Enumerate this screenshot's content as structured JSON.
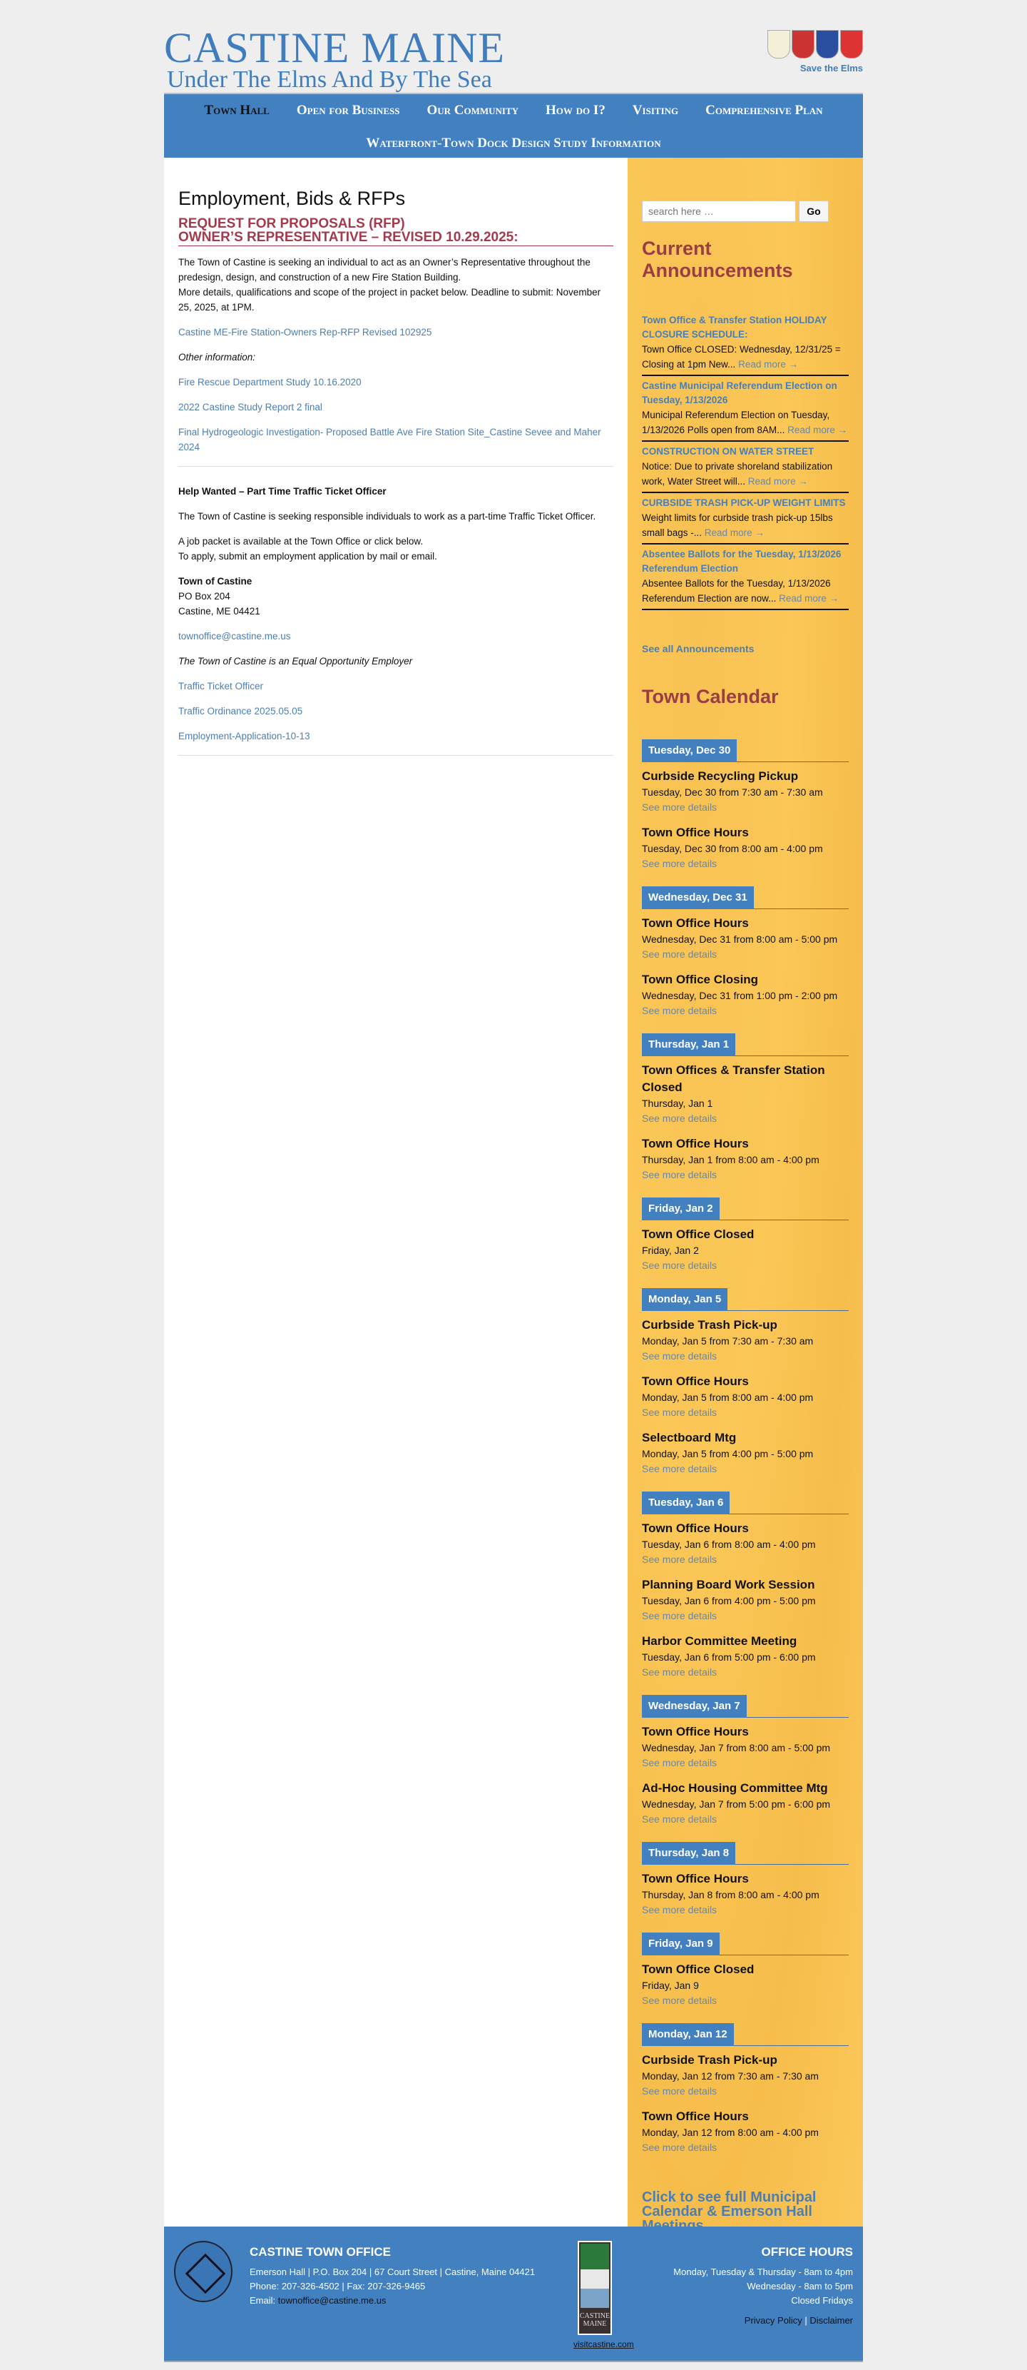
{
  "header": {
    "title": "CASTINE MAINE",
    "tagline": "Under The Elms And By The Sea",
    "save_elms": "Save the Elms",
    "flag_colors": [
      "#f4f0d8",
      "#c33",
      "#2b4fa0",
      "#d33"
    ]
  },
  "nav": {
    "row1": [
      "Town Hall",
      "Open for Business",
      "Our Community",
      "How do I?",
      "Visiting",
      "Comprehensive Plan"
    ],
    "row2": [
      "Waterfront-Town Dock Design Study Information"
    ]
  },
  "main": {
    "title": "Employment, Bids & RFPs",
    "rfp_line1": "REQUEST FOR PROPOSALS (RFP)",
    "rfp_line2": "OWNER’S REPRESENTATIVE – REVISED 10.29.2025:",
    "rfp_p1": "The Town of Castine is seeking an individual to act as an Owner’s Representative throughout the predesign, design, and construction of a new Fire Station Building.",
    "rfp_p2": "More details, qualifications and scope of the project in packet below.  Deadline to submit: November 25, 2025, at 1PM.",
    "rfp_link": "Castine ME-Fire Station-Owners Rep-RFP Revised 102925",
    "other_info": "Other information:",
    "other_links": [
      "Fire Rescue Department Study 10.16.2020",
      "2022 Castine Study Report 2 final",
      "Final Hydrogeologic Investigation- Proposed Battle Ave Fire Station Site_Castine Sevee and Maher 2024"
    ],
    "job_title": "Help Wanted – Part Time Traffic Ticket Officer",
    "job_p1": "The Town of Castine is seeking responsible individuals to work as a part-time Traffic Ticket Officer.",
    "job_p2a": "A job packet is available at the Town Office or click below.",
    "job_p2b": "To apply, submit an employment application by mail or email.",
    "addr_name": "Town of Castine",
    "addr_1": "PO Box 204",
    "addr_2": "Castine, ME 04421",
    "email": "townoffice@castine.me.us",
    "eoe": "The Town of Castine is an Equal Opportunity Employer",
    "job_links": [
      "Traffic Ticket Officer",
      "Traffic Ordinance 2025.05.05",
      "Employment-Application-10-13"
    ]
  },
  "sidebar": {
    "search_placeholder": "search here …",
    "search_button": "Go",
    "announcements_title": "Current Announcements",
    "announcements": [
      {
        "title": "Town Office & Transfer Station HOLIDAY CLOSURE SCHEDULE:",
        "body": "Town Office CLOSED: Wednesday, 12/31/25 = Closing at 1pm New...",
        "more": "Read more →"
      },
      {
        "title": "Castine Municipal Referendum Election on Tuesday, 1/13/2026",
        "body": "Municipal Referendum Election on Tuesday, 1/13/2026 Polls open from 8AM...",
        "more": "Read more →"
      },
      {
        "title": "CONSTRUCTION ON WATER STREET",
        "body": "Notice: Due to private shoreland stabilization work, Water Street will...",
        "more": "Read more →"
      },
      {
        "title": "CURBSIDE TRASH PICK-UP WEIGHT LIMITS",
        "body": "Weight limits for curbside trash pick-up 15lbs small bags -...",
        "more": "Read more →"
      },
      {
        "title": "Absentee Ballots for the Tuesday, 1/13/2026 Referendum Election",
        "body": "Absentee Ballots for the Tuesday, 1/13/2026 Referendum Election are now...",
        "more": "Read more →"
      }
    ],
    "see_all": "See all Announcements",
    "calendar_title": "Town Calendar",
    "see_more": "See more details",
    "days": [
      {
        "date": "Tuesday, Dec 30",
        "events": [
          {
            "title": "Curbside Recycling Pickup",
            "when": "Tuesday, Dec 30 from 7:30 am - 7:30 am"
          },
          {
            "title": "Town Office Hours",
            "when": "Tuesday, Dec 30 from 8:00 am - 4:00 pm"
          }
        ]
      },
      {
        "date": "Wednesday, Dec 31",
        "events": [
          {
            "title": "Town Office Hours",
            "when": "Wednesday, Dec 31 from 8:00 am - 5:00 pm"
          },
          {
            "title": "Town Office Closing",
            "when": "Wednesday, Dec 31 from 1:00 pm - 2:00 pm"
          }
        ]
      },
      {
        "date": "Thursday, Jan 1",
        "events": [
          {
            "title": "Town Offices & Transfer Station Closed",
            "when": "Thursday, Jan 1"
          },
          {
            "title": "Town Office Hours",
            "when": "Thursday, Jan 1 from 8:00 am - 4:00 pm"
          }
        ]
      },
      {
        "date": "Friday, Jan 2",
        "events": [
          {
            "title": "Town Office Closed",
            "when": "Friday, Jan 2"
          }
        ]
      },
      {
        "date": "Monday, Jan 5",
        "events": [
          {
            "title": "Curbside Trash Pick-up",
            "when": "Monday, Jan 5 from 7:30 am - 7:30 am"
          },
          {
            "title": "Town Office Hours",
            "when": "Monday, Jan 5 from 8:00 am - 4:00 pm"
          },
          {
            "title": "Selectboard Mtg",
            "when": "Monday, Jan 5 from 4:00 pm - 5:00 pm"
          }
        ]
      },
      {
        "date": "Tuesday, Jan 6",
        "events": [
          {
            "title": "Town Office Hours",
            "when": "Tuesday, Jan 6 from 8:00 am - 4:00 pm"
          },
          {
            "title": "Planning Board Work Session",
            "when": "Tuesday, Jan 6 from 4:00 pm - 5:00 pm"
          },
          {
            "title": "Harbor Committee Meeting",
            "when": "Tuesday, Jan 6 from 5:00 pm - 6:00 pm"
          }
        ]
      },
      {
        "date": "Wednesday, Jan 7",
        "events": [
          {
            "title": "Town Office Hours",
            "when": "Wednesday, Jan 7 from 8:00 am - 5:00 pm"
          },
          {
            "title": "Ad-Hoc Housing Committee Mtg",
            "when": "Wednesday, Jan 7 from 5:00 pm - 6:00 pm"
          }
        ]
      },
      {
        "date": "Thursday, Jan 8",
        "events": [
          {
            "title": "Town Office Hours",
            "when": "Thursday, Jan 8 from 8:00 am - 4:00 pm"
          }
        ]
      },
      {
        "date": "Friday, Jan 9",
        "events": [
          {
            "title": "Town Office Closed",
            "when": "Friday, Jan 9"
          }
        ]
      },
      {
        "date": "Monday, Jan 12",
        "events": [
          {
            "title": "Curbside Trash Pick-up",
            "when": "Monday, Jan 12 from 7:30 am - 7:30 am"
          },
          {
            "title": "Town Office Hours",
            "when": "Monday, Jan 12 from 8:00 am - 4:00 pm"
          }
        ]
      }
    ],
    "calendar_link": "Click to see full Municipal Calendar & Emerson Hall Meetings."
  },
  "footer": {
    "office_title": "CASTINE TOWN OFFICE",
    "address": "Emerson Hall | P.O. Box 204 | 67 Court Street | Castine, Maine 04421",
    "phone": "Phone: 207-326-4502 | Fax: 207-326-9465",
    "email_label": "Email: ",
    "email": "townoffice@castine.me.us",
    "visit_logo_text": "CASTINE MAINE",
    "visit_link": "visitcastine.com",
    "hours_title": "OFFICE HOURS",
    "hours": [
      "Monday, Tuesday & Thursday - 8am to 4pm",
      "Wednesday - 8am to 5pm",
      "Closed Fridays"
    ],
    "privacy": "Privacy Policy",
    "sep": " | ",
    "disclaimer": "Disclaimer"
  }
}
